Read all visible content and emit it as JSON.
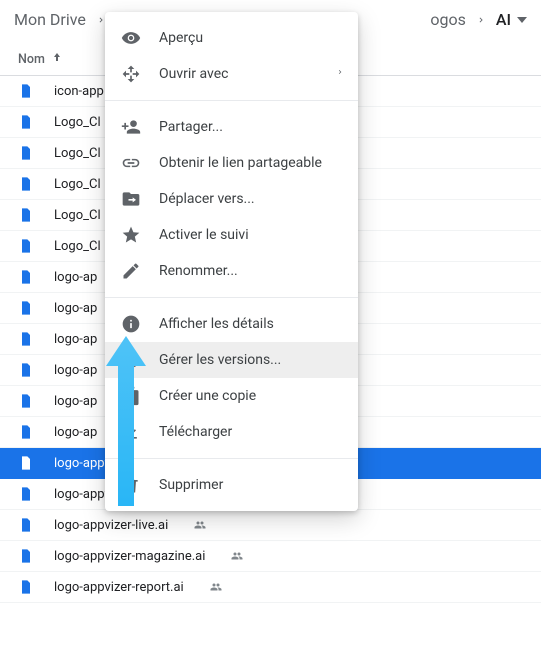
{
  "breadcrumbs": {
    "root": "Mon Drive",
    "tail_folder": "ogos",
    "current": "AI"
  },
  "column_header": "Nom",
  "files": [
    {
      "name": "icon-app",
      "shared": false
    },
    {
      "name": "Logo_Cl",
      "shared": false
    },
    {
      "name": "Logo_Cl",
      "shared": false
    },
    {
      "name": "Logo_Cl",
      "shared": false
    },
    {
      "name": "Logo_Cl",
      "shared": false
    },
    {
      "name": "Logo_Cl",
      "shared": false
    },
    {
      "name": "logo-ap",
      "shared": false
    },
    {
      "name": "logo-ap",
      "shared": false
    },
    {
      "name": "logo-ap",
      "shared": false
    },
    {
      "name": "logo-ap",
      "shared": false
    },
    {
      "name": "logo-ap",
      "shared": false
    },
    {
      "name": "logo-ap",
      "shared": false
    },
    {
      "name": "logo-appvizer-fr.ai",
      "shared": true,
      "selected": true
    },
    {
      "name": "logo-appvizer-link.ai",
      "shared": true
    },
    {
      "name": "logo-appvizer-live.ai",
      "shared": true
    },
    {
      "name": "logo-appvizer-magazine.ai",
      "shared": true
    },
    {
      "name": "logo-appvizer-report.ai",
      "shared": true
    }
  ],
  "menu": {
    "preview": "Aperçu",
    "open_with": "Ouvrir avec",
    "share": "Partager...",
    "get_link": "Obtenir le lien partageable",
    "move_to": "Déplacer vers...",
    "star": "Activer le suivi",
    "rename": "Renommer...",
    "details": "Afficher les détails",
    "versions": "Gérer les versions...",
    "make_copy": "Créer une copie",
    "download": "Télécharger",
    "remove": "Supprimer"
  },
  "colors": {
    "selected_bg": "#1a73e8",
    "file_icon": "#1a73e8",
    "muted": "#5f6368",
    "cursor": "#4fc3f7"
  }
}
